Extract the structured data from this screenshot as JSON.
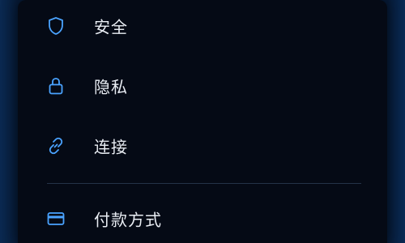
{
  "menu": {
    "items": [
      {
        "icon": "shield-icon",
        "label": "安全"
      },
      {
        "icon": "lock-icon",
        "label": "隐私"
      },
      {
        "icon": "link-icon",
        "label": "连接"
      },
      {
        "icon": "credit-card-icon",
        "label": "付款方式"
      }
    ]
  },
  "colors": {
    "panel_background": "#050a15",
    "page_background": "#061a36",
    "icon_accent": "#4aa3ff",
    "label_text": "#e9edf3",
    "divider": "#243247"
  }
}
